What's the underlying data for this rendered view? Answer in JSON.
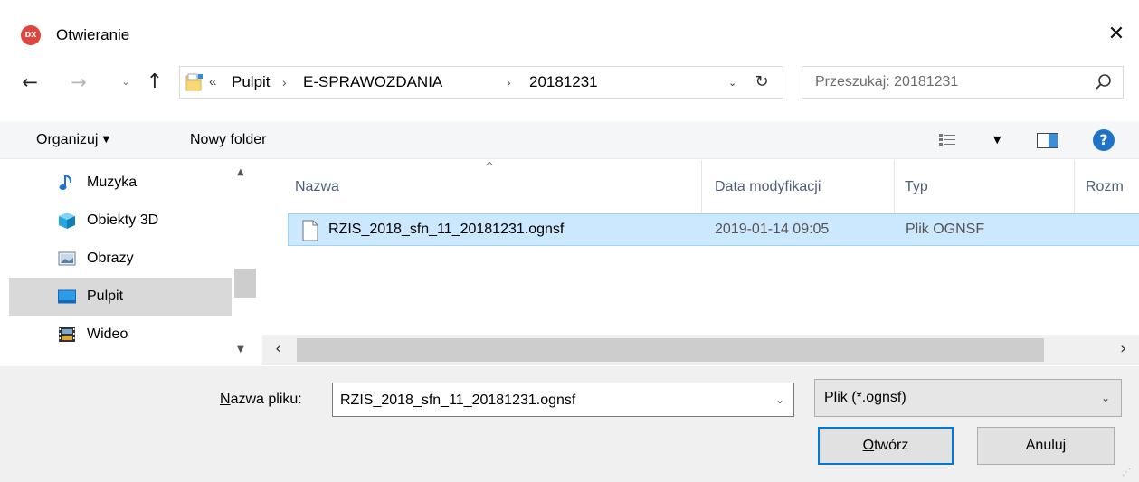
{
  "window": {
    "app_icon_text": "DX",
    "title": "Otwieranie",
    "close_glyph": "✕"
  },
  "navigation": {
    "back_glyph": "←",
    "forward_glyph": "→",
    "recent_glyph": "⌄",
    "up_glyph": "↑",
    "address": {
      "overflow": "«",
      "crumbs": [
        "Pulpit",
        "E-SPRAWOZDANIA",
        "20181231"
      ],
      "separator": "›",
      "dropdown_glyph": "⌄",
      "refresh_glyph": "↻"
    },
    "search": {
      "placeholder": "Przeszukaj: 20181231"
    }
  },
  "toolbar": {
    "organize_label": "Organizuj",
    "organize_arrow": "▼",
    "new_folder_label": "Nowy folder",
    "view_dropdown_glyph": "▼",
    "help_glyph": "?"
  },
  "nav_pane": {
    "items": [
      {
        "label": "Muzyka",
        "icon": "music-icon"
      },
      {
        "label": "Obiekty 3D",
        "icon": "objects-3d-icon"
      },
      {
        "label": "Obrazy",
        "icon": "pictures-icon"
      },
      {
        "label": "Pulpit",
        "icon": "desktop-icon",
        "selected": true
      },
      {
        "label": "Wideo",
        "icon": "video-icon"
      }
    ],
    "scroll_up_glyph": "▲",
    "scroll_down_glyph": "▼"
  },
  "file_list": {
    "columns": [
      "Nazwa",
      "Data modyfikacji",
      "Typ",
      "Rozm"
    ],
    "sort_glyph": "^",
    "rows": [
      {
        "name": "RZIS_2018_sfn_11_20181231.ognsf",
        "modified": "2019-01-14 09:05",
        "type": "Plik OGNSF",
        "selected": true
      }
    ],
    "scroll_left_glyph": "‹",
    "scroll_right_glyph": "›"
  },
  "bottom": {
    "filename_label_underlined": "N",
    "filename_label_rest": "azwa pliku:",
    "filename_value": "RZIS_2018_sfn_11_20181231.ognsf",
    "filename_dropdown_glyph": "⌄",
    "filetype_value": "Plik (*.ognsf)",
    "filetype_dropdown_glyph": "⌄",
    "open_label_underlined": "O",
    "open_label_rest": "twórz",
    "cancel_label": "Anuluj",
    "grip_glyph": "⋰"
  },
  "colors": {
    "accent": "#0078d7",
    "selection_bg": "#cce8ff",
    "selection_border": "#99d1ff",
    "header_text": "#4c607a",
    "app_icon_bg": "#e0443e"
  }
}
